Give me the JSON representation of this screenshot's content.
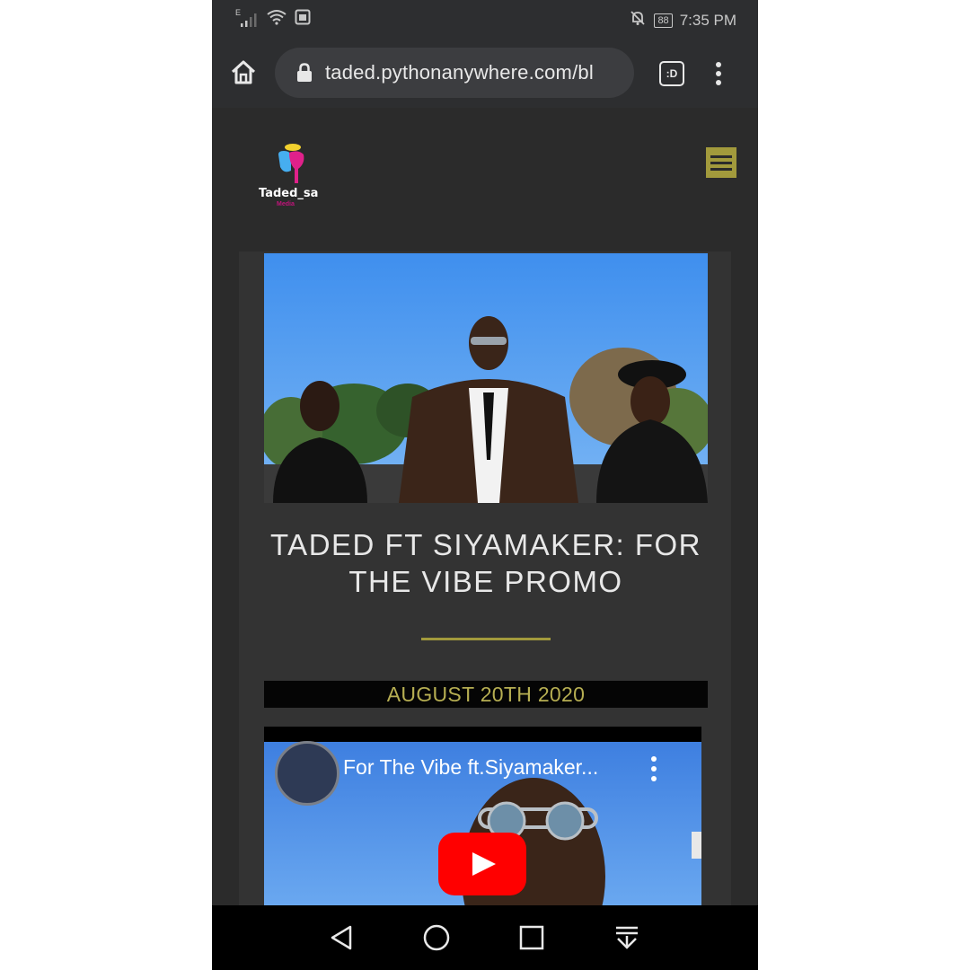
{
  "status_bar": {
    "network": "E",
    "battery": "88",
    "time": "7:35 PM"
  },
  "browser": {
    "url": "taded.pythonanywhere.com/bl",
    "tab_badge": ":D"
  },
  "site": {
    "logo_text": "Taded_sa",
    "logo_sub": "Media"
  },
  "post": {
    "title": "TADED FT SIYAMAKER: FOR THE VIBE PROMO",
    "date": "AUGUST 20TH 2020"
  },
  "video": {
    "title": "For The Vibe ft.Siyamaker..."
  },
  "colors": {
    "accent_gold": "#a29a3c",
    "date_text": "#b6ae52",
    "page_bg": "#2b2b2b",
    "youtube_red": "#ff0000"
  },
  "icons": {
    "home": "home-icon",
    "lock": "lock-icon",
    "menu": "more-vert-icon",
    "hamburger": "hamburger-menu-icon",
    "play": "youtube-play-icon",
    "back": "back-triangle-icon",
    "home_nav": "home-circle-icon",
    "recents": "recents-square-icon",
    "notifications": "pull-down-icon"
  }
}
